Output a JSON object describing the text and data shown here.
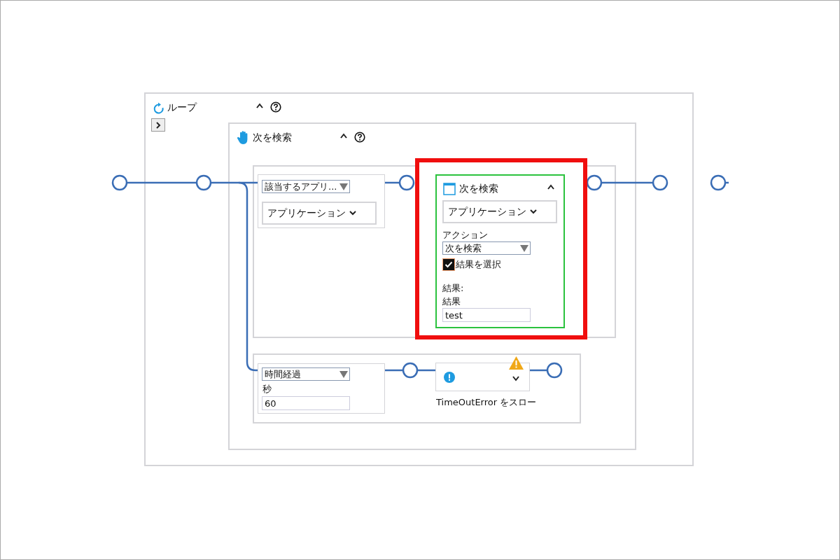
{
  "loop": {
    "title": "ループ"
  },
  "find_group": {
    "title": "次を検索"
  },
  "branch_top": {
    "condition": "該当するアプリ...",
    "target": "アプリケーション"
  },
  "find_next_card": {
    "title": "次を検索",
    "target": "アプリケーション",
    "action_label": "アクション",
    "action": "次を検索",
    "select_result": {
      "label": "結果を選択",
      "checked": true
    },
    "result_heading": "結果:",
    "result_label": "結果",
    "result_value": "test"
  },
  "branch_bottom": {
    "condition": "時間経過",
    "seconds_label": "秒",
    "seconds_value": "60"
  },
  "throw_step": {
    "caption": "TimeOutError をスロー",
    "warning": true
  }
}
